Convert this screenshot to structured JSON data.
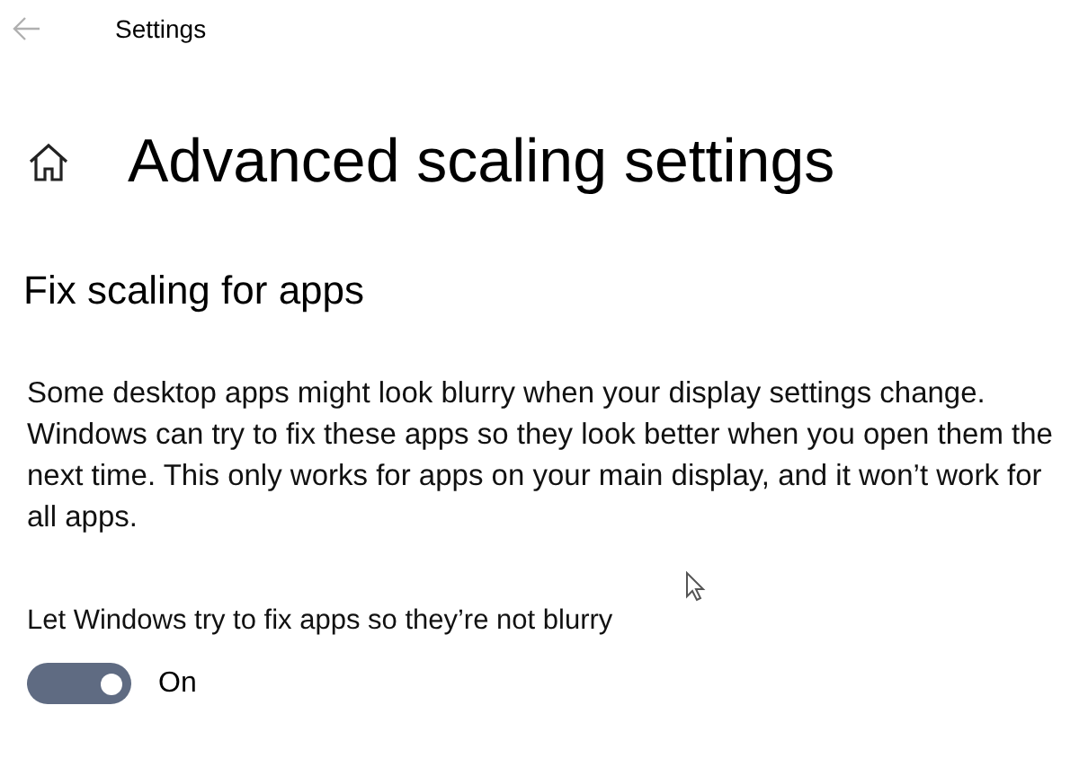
{
  "window": {
    "title": "Settings"
  },
  "page": {
    "title": "Advanced scaling settings"
  },
  "section": {
    "heading": "Fix scaling for apps",
    "description": "Some desktop apps might look blurry when your display settings change. Windows can try to fix these apps so they look better when you open them the next time. This only works for apps on your main display, and it won’t work for all apps."
  },
  "toggle": {
    "label": "Let Windows try to fix apps so they’re not blurry",
    "on": true,
    "state_text": "On"
  }
}
